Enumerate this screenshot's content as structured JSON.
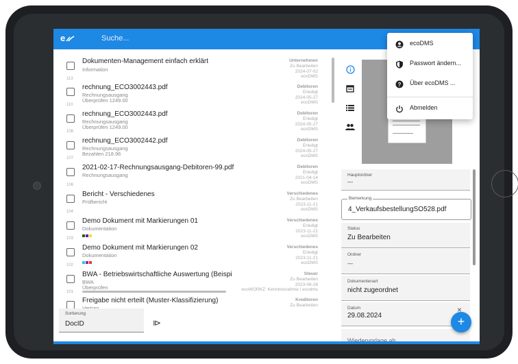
{
  "appbar": {
    "logo": "e",
    "search_placeholder": "Suche..."
  },
  "documents": [
    {
      "num": "113",
      "title": "Dokumenten-Management einfach erklärt",
      "sub1": "Information",
      "sub2": "",
      "category": "Unternehmen",
      "status": "Zu Bearbeiten",
      "date": "2024-07-02",
      "owner": "ecoDMS"
    },
    {
      "num": "110",
      "title": "rechnung_ECO3002443.pdf",
      "sub1": "Rechnungsausgang",
      "sub2": "Überprüfen   1249.00",
      "category": "Debitoren",
      "status": "Erledigt",
      "date": "2024-05-27",
      "owner": "ecoDMS"
    },
    {
      "num": "108",
      "title": "rechnung_ECO3002443.pdf",
      "sub1": "Rechnungsausgang",
      "sub2": "Überprüfen   1249.00",
      "category": "Debitoren",
      "status": "Erledigt",
      "date": "2024-05-27",
      "owner": "ecoDMS"
    },
    {
      "num": "107",
      "title": "rechnung_ECO3002442.pdf",
      "sub1": "Rechnungsausgang",
      "sub2": "Bezahlen   218.96",
      "category": "Debitoren",
      "status": "Erledigt",
      "date": "2024-05-27",
      "owner": "ecoDMS"
    },
    {
      "num": "106",
      "title": "2021-02-17-Rechnungsausgang-Debitoren-99.pdf",
      "sub1": "Rechnungsausgang",
      "sub2": "",
      "category": "Debitoren",
      "status": "Erledigt",
      "date": "2021-04-14",
      "owner": "ecoDMS"
    },
    {
      "num": "104",
      "title": "Bericht - Verschiedenes",
      "sub1": "Prüfbericht",
      "sub2": "",
      "category": "Verschiedenes",
      "status": "Zu Bearbeiten",
      "date": "2023-11-21",
      "owner": "ecoDMS"
    },
    {
      "num": "103",
      "title": "Demo Dokument mit Markierungen 01",
      "sub1": "Dokumentation",
      "sub2": "",
      "category": "Verschiedenes",
      "status": "Erledigt",
      "date": "2023-11-21",
      "owner": "ecoDMS"
    },
    {
      "num": "102",
      "title": "Demo Dokument mit Markierungen 02",
      "sub1": "Dokumentation",
      "sub2": "",
      "category": "Verschiedenes",
      "status": "Erledigt",
      "date": "2023-11-21",
      "owner": "ecoDMS"
    },
    {
      "num": "101",
      "title": "BWA - Betriebswirtschaftliche Auswertung (Beispi",
      "sub1": "BWA",
      "sub2": "Überprüfen",
      "category": "Steuer",
      "status": "Zu Bearbeiten",
      "date": "2023-06-28",
      "owner": "ecoWORKZ: Kenntnisnahme / ecodms"
    },
    {
      "num": "",
      "title": "Freigabe nicht erteilt (Muster-Klassifizierung)",
      "sub1": "Vertrag",
      "sub2": "",
      "category": "Kreditoren",
      "status": "Zu Bearbeiten",
      "date": "",
      "owner": ""
    }
  ],
  "swatches": {
    "row6": [
      "#1b5e20",
      "#6a1b9a",
      "#fdd835"
    ],
    "row7": [
      "#26c6da",
      "#8e24aa",
      "#e53935"
    ]
  },
  "sort": {
    "label": "Sortierung",
    "value": "DocID",
    "direction_symbol": "⧐"
  },
  "sidebar": [
    "info-icon",
    "calendar-icon",
    "list-icon",
    "people-icon"
  ],
  "fields": {
    "hauptordner": {
      "label": "Hauptordner",
      "value": "---"
    },
    "bemerkung": {
      "label": "Bemerkung",
      "value": "4_VerkaufsbestellungSO528.pdf"
    },
    "status": {
      "label": "Status",
      "value": "Zu Bearbeiten"
    },
    "ordner": {
      "label": "Ordner",
      "value": "---"
    },
    "dokumentenart": {
      "label": "Dokumentenart",
      "value": "nicht zugeordnet"
    },
    "datum": {
      "label": "Datum",
      "value": "29.08.2024",
      "clear": "×"
    },
    "wiedervorlage": {
      "label": "Wiedervorlage ab"
    }
  },
  "fab": "+",
  "menu": {
    "items": [
      {
        "label": "ecoDMS",
        "icon": "account-circle-icon"
      },
      {
        "label": "Passwort ändern...",
        "icon": "shield-icon"
      },
      {
        "label": "Über ecoDMS ...",
        "icon": "help-icon"
      },
      {
        "label": "Abmelden",
        "icon": "power-icon"
      }
    ]
  },
  "colors": {
    "primary": "#1e88e5"
  }
}
